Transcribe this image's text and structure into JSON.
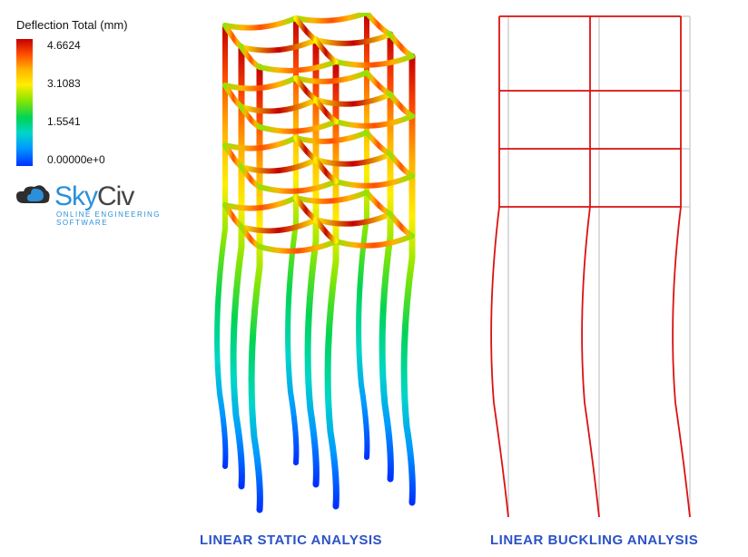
{
  "legend": {
    "title": "Deflection Total (mm)",
    "ticks": [
      "4.6624",
      "3.1083",
      "1.5541",
      "0.00000e+0"
    ],
    "colors": {
      "max": "#c40000",
      "min": "#0030ff"
    }
  },
  "logo": {
    "brand_a": "Sky",
    "brand_b": "Civ",
    "tagline": "ONLINE ENGINEERING SOFTWARE"
  },
  "captions": {
    "left": "LINEAR STATIC ANALYSIS",
    "right": "LINEAR BUCKLING ANALYSIS"
  },
  "analysis": {
    "left_type": "linear_static",
    "right_type": "linear_buckling",
    "result_quantity": "Deflection Total",
    "unit": "mm",
    "max_value": 4.6624,
    "min_value": 0.0
  }
}
